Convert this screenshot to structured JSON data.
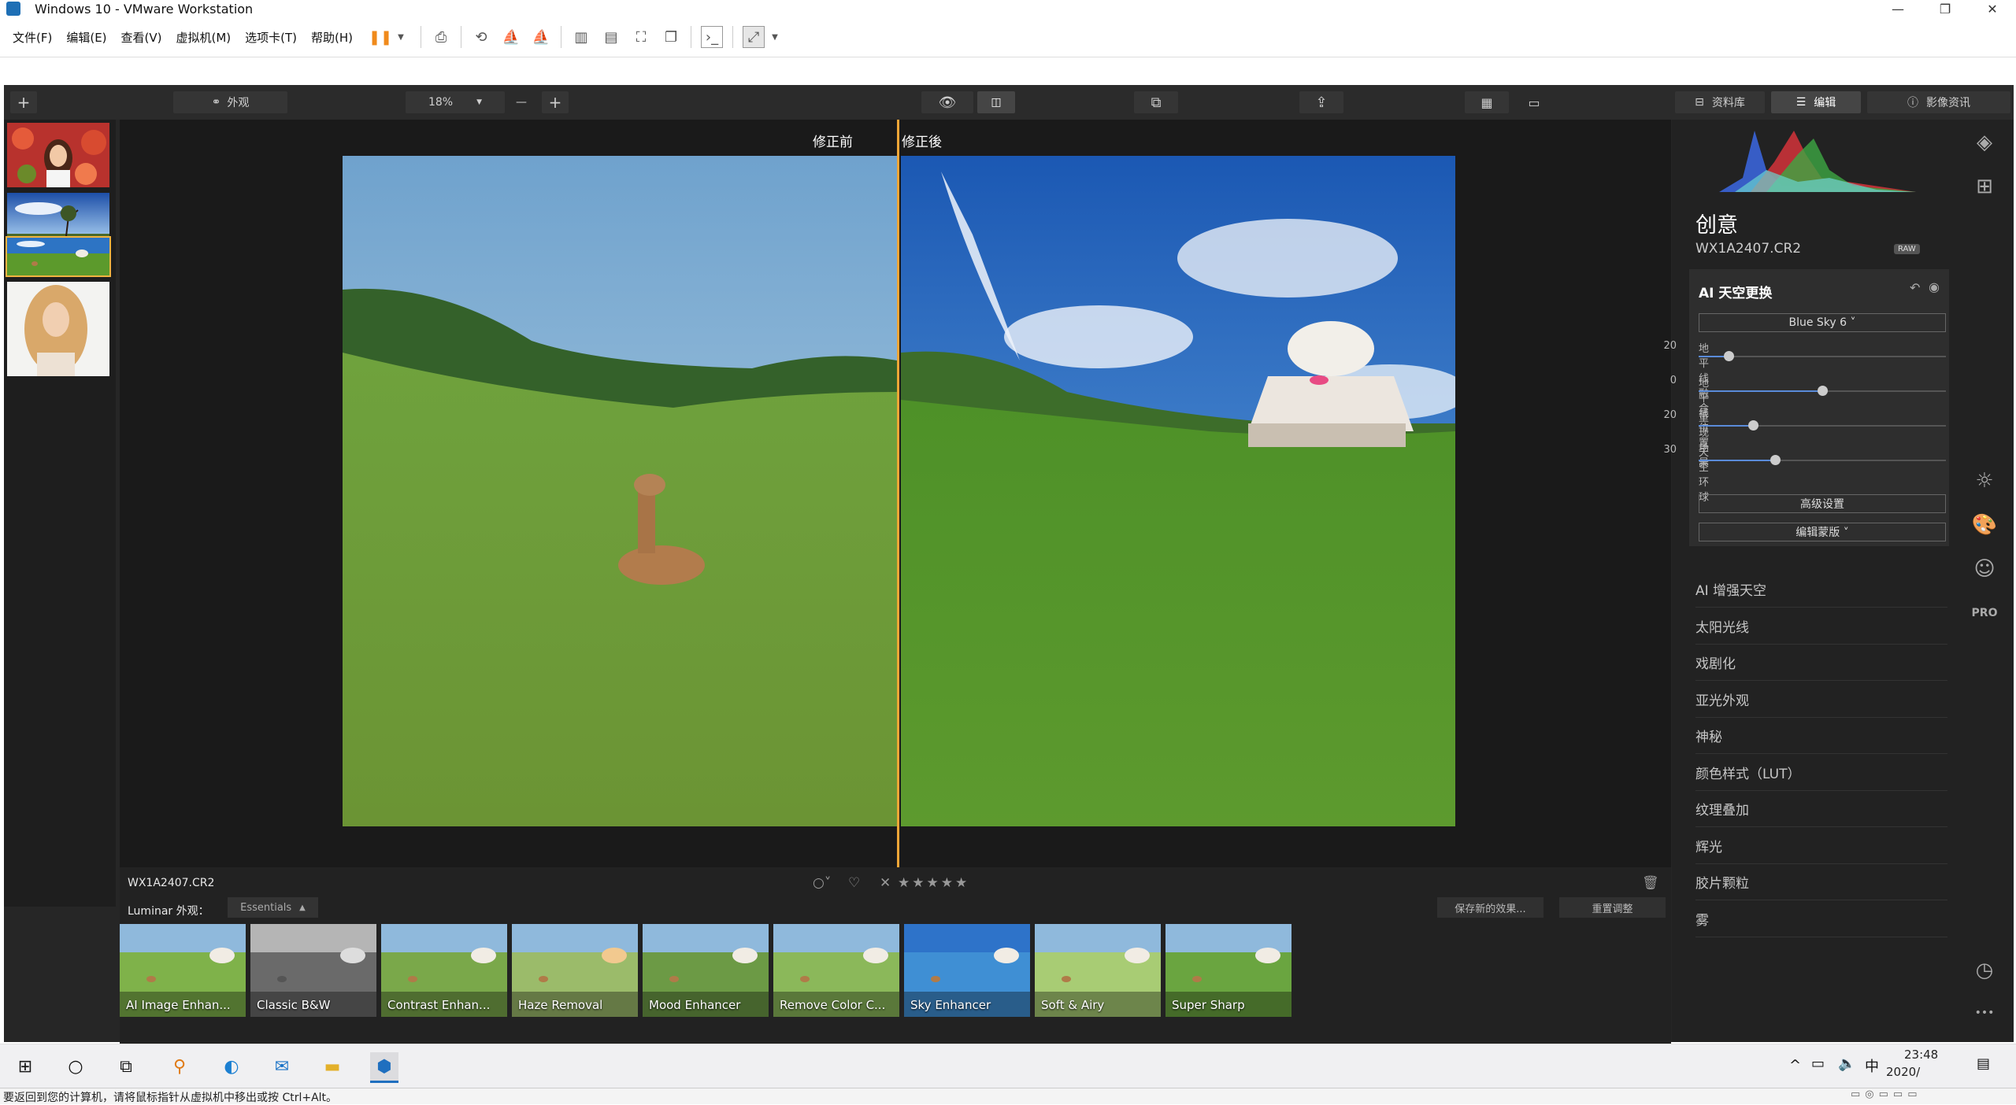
{
  "window": {
    "title": "Windows 10 - VMware Workstation",
    "controls": {
      "minimize": "—",
      "maximize": "❐",
      "close": "✕"
    }
  },
  "menubar": [
    "文件(F)",
    "编辑(E)",
    "查看(V)",
    "虚拟机(M)",
    "选项卡(T)",
    "帮助(H)"
  ],
  "app_toolbar": {
    "add": "+",
    "looks": "外观",
    "zoom": "18%",
    "zoom_minus": "—",
    "zoom_plus": "+",
    "tabs": {
      "library": "资料库",
      "edit": "编辑",
      "info": "影像资讯"
    }
  },
  "compare": {
    "before": "修正前",
    "after": "修正後"
  },
  "info_bar": {
    "file_name": "WX1A2407.CR2",
    "looks_label": "Luminar 外观：",
    "looks_category": "Essentials",
    "save_look": "保存新的效果...",
    "reset": "重置调整",
    "rating_stars": 0
  },
  "looks": [
    "AI Image Enhan...",
    "Classic B&W",
    "Contrast Enhan...",
    "Haze Removal",
    "Mood Enhancer",
    "Remove Color C...",
    "Sky Enhancer",
    "Soft & Airy",
    "Super Sharp"
  ],
  "panel": {
    "title": "创意",
    "file": "WX1A2407.CR2",
    "raw_badge": "RAW",
    "ai_sky": {
      "title": "AI 天空更换",
      "sky_select": "Blue Sky 6 ˅",
      "sliders": [
        {
          "label": "地平线融合",
          "value": "20",
          "fraction": 0.12
        },
        {
          "label": "地平线位置",
          "value": "0",
          "fraction": 0.5
        },
        {
          "label": "重现场景",
          "value": "20",
          "fraction": 0.22
        },
        {
          "label": "天空环球",
          "value": "30",
          "fraction": 0.31
        }
      ],
      "advanced": "高级设置",
      "edit_mask": "编辑蒙版 ˅"
    },
    "tools": [
      "AI 增强天空",
      "太阳光线",
      "戏剧化",
      "亚光外观",
      "神秘",
      "颜色样式（LUT）",
      "纹理叠加",
      "辉光",
      "胶片颗粒",
      "雾"
    ]
  },
  "right_icons": {
    "pro": "PRO",
    "more": "•••"
  },
  "taskbar": {
    "time": "23:48",
    "date": "2020/",
    "ime": "中"
  },
  "status": {
    "message": "要返回到您的计算机，请将鼠标指针从虚拟机中移出或按 Ctrl+Alt。"
  }
}
